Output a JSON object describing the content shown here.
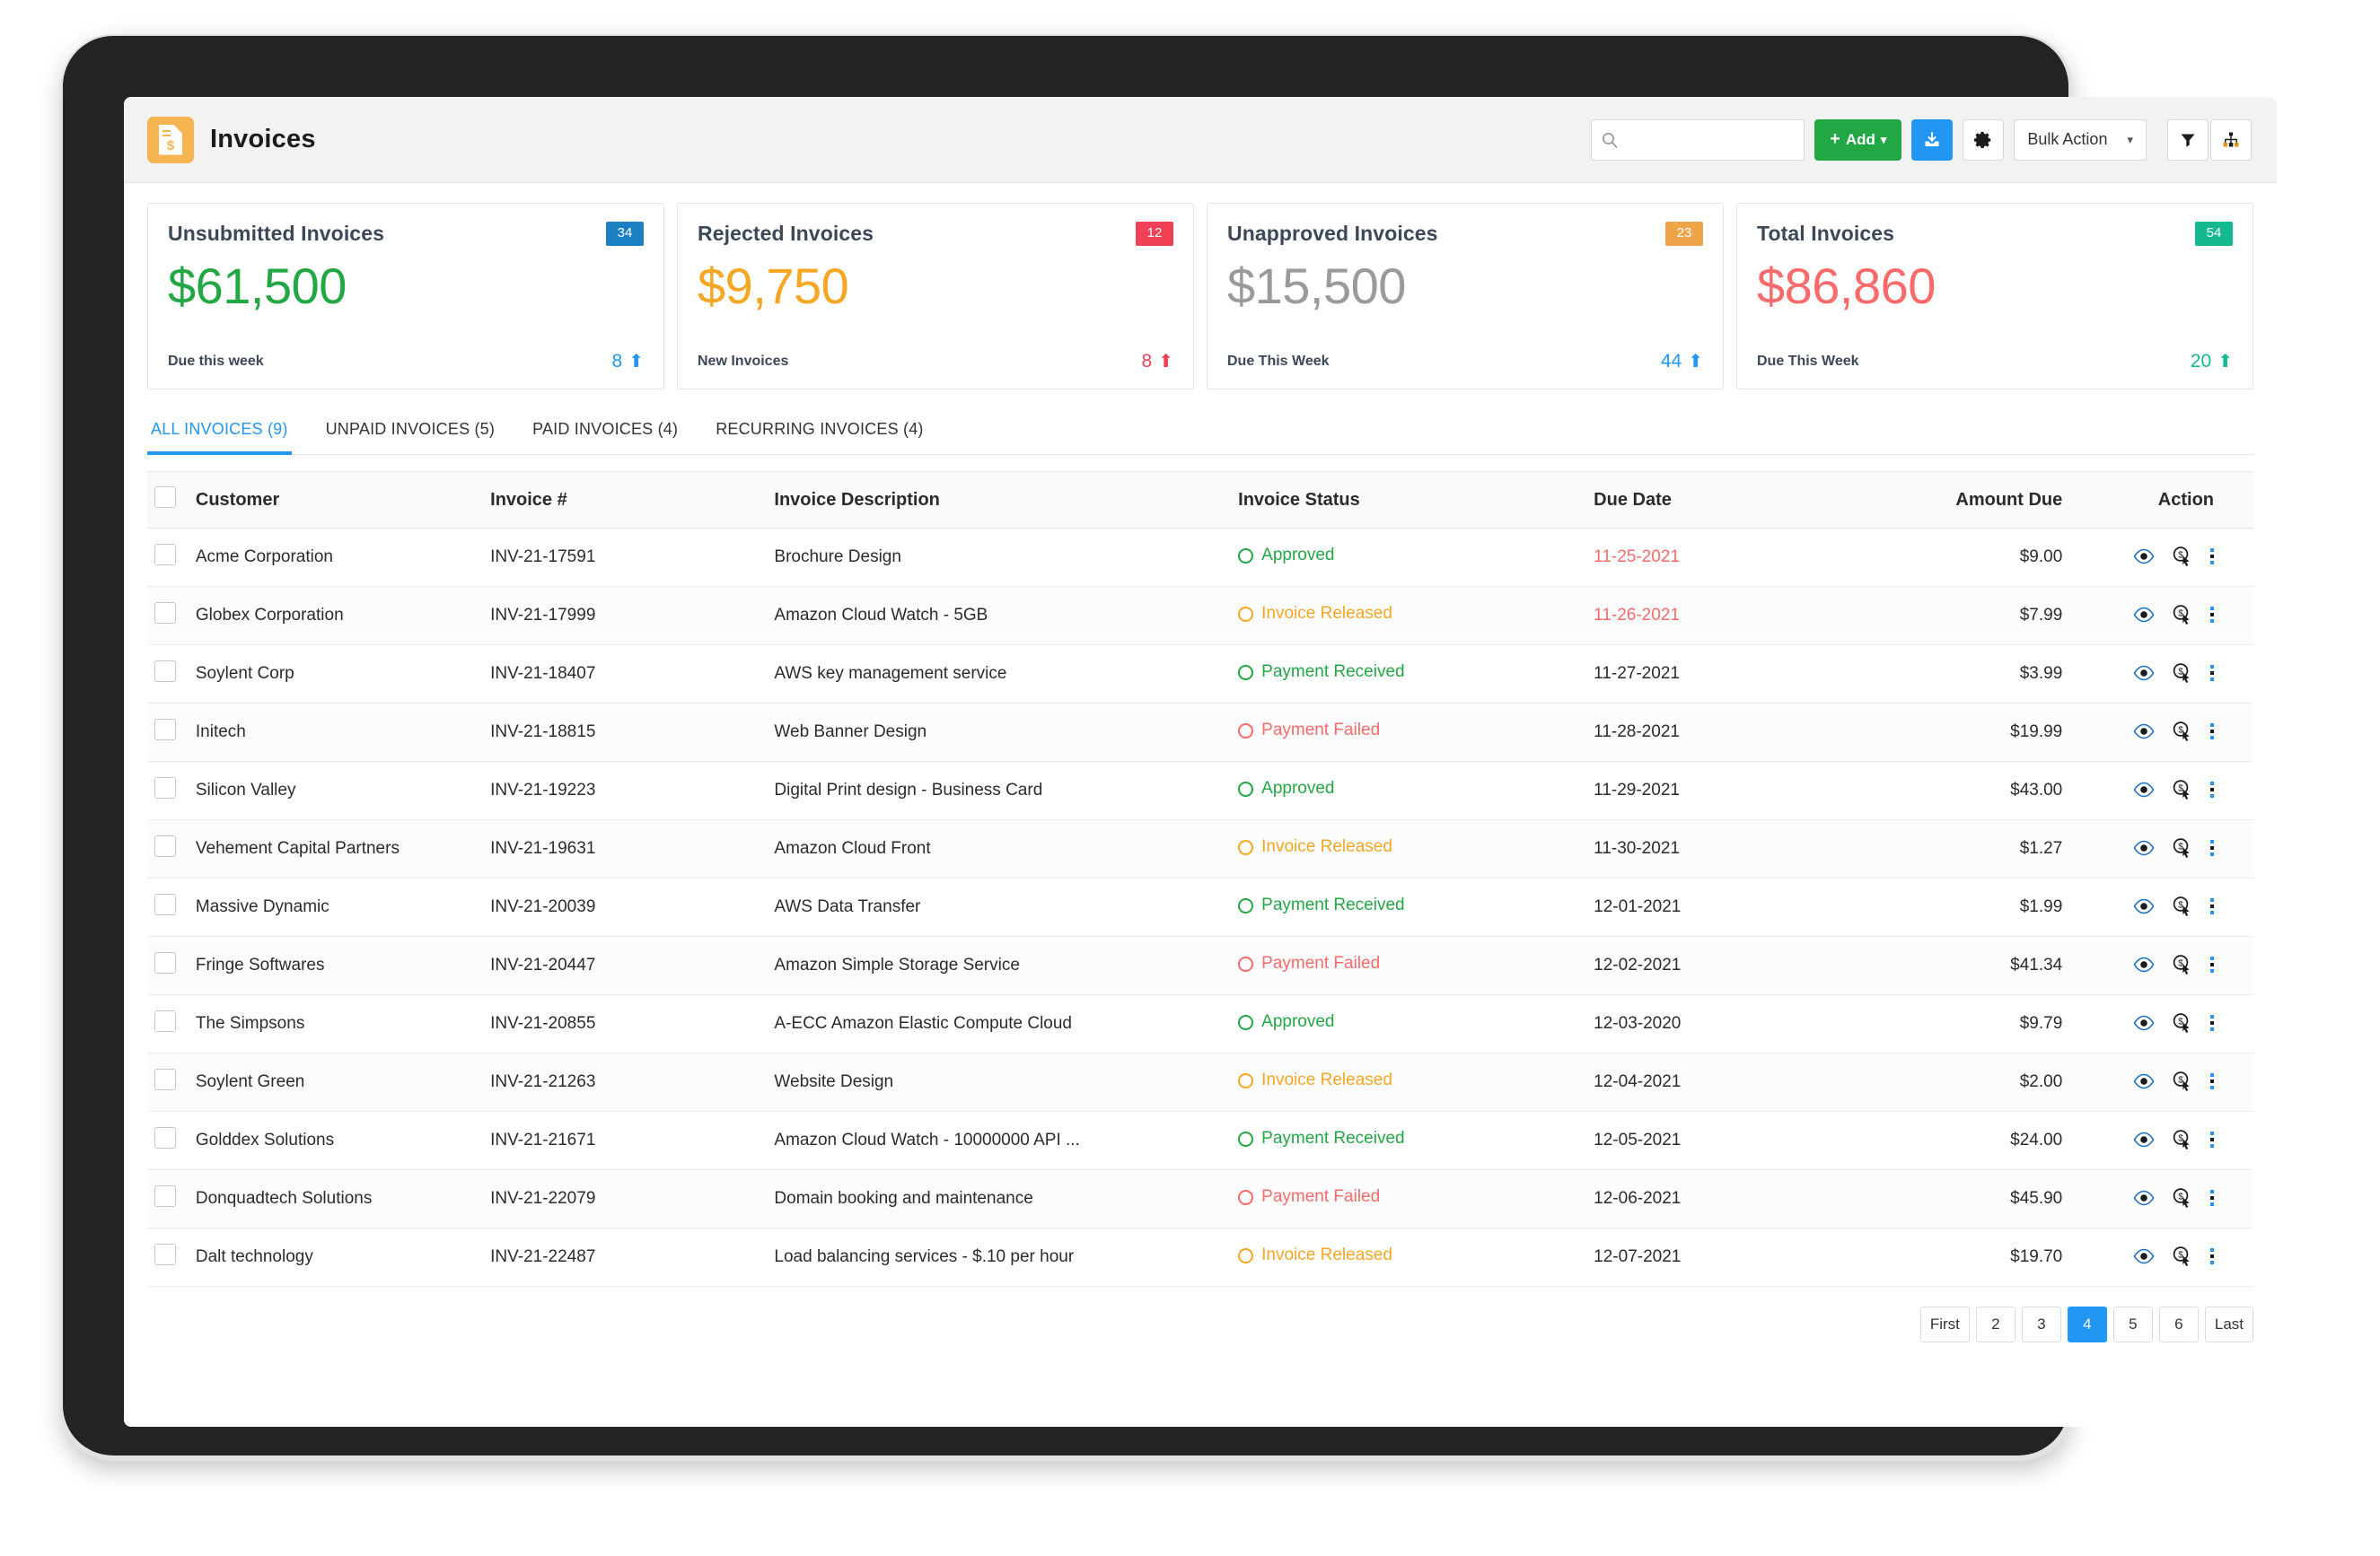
{
  "header": {
    "title": "Invoices",
    "brand_icon": "invoice-document-icon",
    "brand_color": "#f6b551"
  },
  "toolbar": {
    "search_placeholder": "",
    "search_value": "",
    "search_icon": "search-icon",
    "add_label": "Add",
    "add_color": "#22a745",
    "download_icon": "download-inbox-icon",
    "download_color": "#2196f3",
    "settings_icon": "gear-icon",
    "bulk_action_label": "Bulk Action",
    "filter_icon": "filter-funnel-icon",
    "sitemap_icon": "sitemap-hierarchy-icon"
  },
  "stats": [
    {
      "title": "Unsubmitted Invoices",
      "badge": "34",
      "badge_color": "#1b7fc4",
      "value": "$61,500",
      "value_color": "#22a745",
      "foot_label": "Due this week",
      "foot_value": "8",
      "foot_color": "#2196f3",
      "foot_arrow": "arrow-up-icon"
    },
    {
      "title": "Rejected Invoices",
      "badge": "12",
      "badge_color": "#ef4056",
      "value": "$9,750",
      "value_color": "#f5a623",
      "foot_label": "New Invoices",
      "foot_value": "8",
      "foot_color": "#ef4056",
      "foot_arrow": "arrow-up-icon"
    },
    {
      "title": "Unapproved Invoices",
      "badge": "23",
      "badge_color": "#f0a44a",
      "value": "$15,500",
      "value_color": "#9a9a9a",
      "foot_label": "Due This Week",
      "foot_value": "44",
      "foot_color": "#2196f3",
      "foot_arrow": "arrow-up-icon"
    },
    {
      "title": "Total Invoices",
      "badge": "54",
      "badge_color": "#14b992",
      "value": "$86,860",
      "value_color": "#fa6a6a",
      "foot_label": "Due This Week",
      "foot_value": "20",
      "foot_color": "#14b992",
      "foot_arrow": "arrow-up-icon"
    }
  ],
  "tabs": [
    {
      "label": "ALL INVOICES (9)",
      "active": true
    },
    {
      "label": "UNPAID INVOICES (5)",
      "active": false
    },
    {
      "label": "PAID INVOICES (4)",
      "active": false
    },
    {
      "label": "RECURRING INVOICES (4)",
      "active": false
    }
  ],
  "table": {
    "columns": [
      "Customer",
      "Invoice #",
      "Invoice Description",
      "Invoice Status",
      "Due Date",
      "Amount Due",
      "Action"
    ],
    "status_colors": {
      "Approved": "#22a745",
      "Payment Received": "#22a745",
      "Invoice Released": "#f5a623",
      "Payment Failed": "#fa6a6a"
    },
    "action_icons": [
      "eye-view-icon",
      "dollar-pay-cursor-icon",
      "more-vertical-dots-icon"
    ],
    "rows": [
      {
        "customer": "Acme Corporation",
        "invoice": "INV-21-17591",
        "description": "Brochure Design",
        "status": "Approved",
        "due": "11-25-2021",
        "due_overdue": true,
        "amount": "$9.00"
      },
      {
        "customer": "Globex Corporation",
        "invoice": "INV-21-17999",
        "description": "Amazon Cloud Watch - 5GB",
        "status": "Invoice Released",
        "due": "11-26-2021",
        "due_overdue": true,
        "amount": "$7.99"
      },
      {
        "customer": "Soylent Corp",
        "invoice": "INV-21-18407",
        "description": "AWS key management service",
        "status": "Payment Received",
        "due": "11-27-2021",
        "due_overdue": false,
        "amount": "$3.99"
      },
      {
        "customer": "Initech",
        "invoice": "INV-21-18815",
        "description": "Web Banner Design",
        "status": "Payment Failed",
        "due": "11-28-2021",
        "due_overdue": false,
        "amount": "$19.99"
      },
      {
        "customer": "Silicon Valley",
        "invoice": "INV-21-19223",
        "description": "Digital Print design - Business Card",
        "status": "Approved",
        "due": "11-29-2021",
        "due_overdue": false,
        "amount": "$43.00"
      },
      {
        "customer": "Vehement Capital Partners",
        "invoice": "INV-21-19631",
        "description": "Amazon Cloud Front",
        "status": "Invoice Released",
        "due": "11-30-2021",
        "due_overdue": false,
        "amount": "$1.27"
      },
      {
        "customer": "Massive Dynamic",
        "invoice": "INV-21-20039",
        "description": "AWS Data Transfer",
        "status": "Payment Received",
        "due": "12-01-2021",
        "due_overdue": false,
        "amount": "$1.99"
      },
      {
        "customer": "Fringe Softwares",
        "invoice": "INV-21-20447",
        "description": "Amazon Simple Storage Service",
        "status": "Payment Failed",
        "due": "12-02-2021",
        "due_overdue": false,
        "amount": "$41.34"
      },
      {
        "customer": "The Simpsons",
        "invoice": "INV-21-20855",
        "description": "A-ECC Amazon Elastic Compute Cloud",
        "status": "Approved",
        "due": "12-03-2020",
        "due_overdue": false,
        "amount": "$9.79"
      },
      {
        "customer": "Soylent Green",
        "invoice": "INV-21-21263",
        "description": "Website Design",
        "status": "Invoice Released",
        "due": "12-04-2021",
        "due_overdue": false,
        "amount": "$2.00"
      },
      {
        "customer": "Golddex Solutions",
        "invoice": "INV-21-21671",
        "description": "Amazon Cloud Watch - 10000000 API ...",
        "status": "Payment Received",
        "due": "12-05-2021",
        "due_overdue": false,
        "amount": "$24.00"
      },
      {
        "customer": "Donquadtech Solutions",
        "invoice": "INV-21-22079",
        "description": "Domain booking and maintenance",
        "status": "Payment Failed",
        "due": "12-06-2021",
        "due_overdue": false,
        "amount": "$45.90"
      },
      {
        "customer": "Dalt technology",
        "invoice": "INV-21-22487",
        "description": "Load balancing services - $.10 per hour",
        "status": "Invoice Released",
        "due": "12-07-2021",
        "due_overdue": false,
        "amount": "$19.70"
      }
    ]
  },
  "pagination": {
    "buttons": [
      {
        "label": "First",
        "active": false
      },
      {
        "label": "2",
        "active": false
      },
      {
        "label": "3",
        "active": false
      },
      {
        "label": "4",
        "active": true
      },
      {
        "label": "5",
        "active": false
      },
      {
        "label": "6",
        "active": false
      },
      {
        "label": "Last",
        "active": false
      }
    ]
  }
}
